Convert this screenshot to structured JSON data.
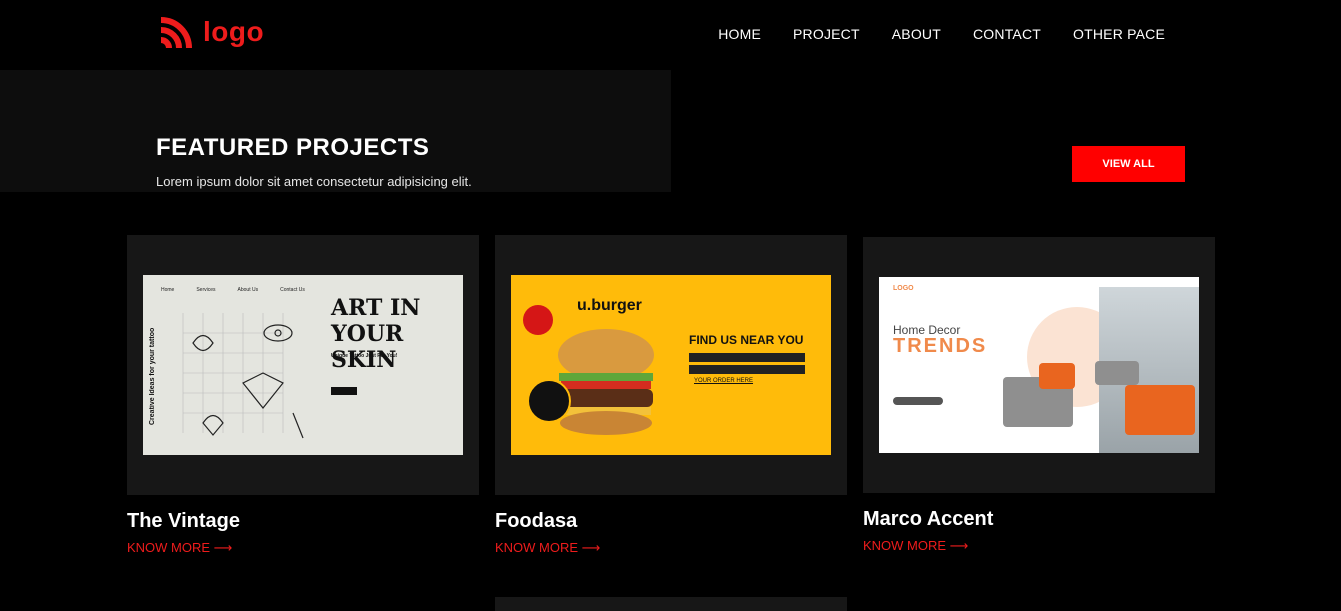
{
  "header": {
    "logo_text": "logo",
    "nav": [
      "HOME",
      "PROJECT",
      "ABOUT",
      "CONTACT",
      "OTHER PACE"
    ]
  },
  "hero": {
    "title": "FEATURED PROJECTS",
    "subtitle": "Lorem ipsum dolor sit amet consectetur adipisicing elit.",
    "view_all": "VIEW ALL"
  },
  "projects": [
    {
      "title": "The Vintage",
      "link": "KNOW MORE ⟶",
      "thumb": {
        "nav": [
          "Home",
          "Services",
          "About Us",
          "Contact Us"
        ],
        "headline": "ART IN YOUR SKIN",
        "side": "Creative Ideas for your tattoo",
        "tag": "Unique Tattoo Just For You!"
      }
    },
    {
      "title": "Foodasa",
      "link": "KNOW MORE ⟶",
      "thumb": {
        "brand": "u.burger",
        "headline": "FIND US NEAR YOU",
        "link": "YOUR ORDER HERE"
      }
    },
    {
      "title": "Marco Accent",
      "link": "KNOW MORE ⟶",
      "thumb": {
        "logo": "LOGO",
        "heading": "Home Decor",
        "headline": "TRENDS"
      }
    }
  ],
  "colors": {
    "accent": "#ff0000",
    "background": "#000000",
    "card": "#171717"
  }
}
